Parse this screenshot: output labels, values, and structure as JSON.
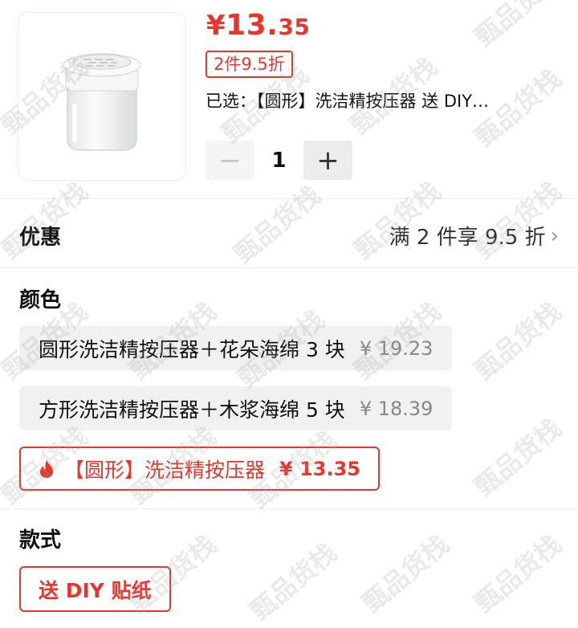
{
  "product": {
    "price_currency": "¥",
    "price_int": "13.",
    "price_dec": "35",
    "promo_tag": "2件9.5折",
    "selected_text": "已选：【圆形】洗洁精按压器 送 DIY…",
    "quantity": "1",
    "minus_symbol": "−",
    "plus_symbol": "+"
  },
  "discount": {
    "label": "优惠",
    "value": "满 2 件享 9.5 折",
    "chevron": "›"
  },
  "color_section": {
    "label": "颜色",
    "options": [
      {
        "name": "圆形洗洁精按压器＋花朵海绵 3 块",
        "price": "¥ 19.23",
        "state": "normal"
      },
      {
        "name": "方形洗洁精按压器＋木浆海绵 5 块",
        "price": "¥ 18.39",
        "state": "normal"
      },
      {
        "name": "【圆形】洗洁精按压器",
        "price": "¥ 13.35",
        "state": "selected",
        "icon": "flame-icon"
      }
    ]
  },
  "style_section": {
    "label": "款式",
    "option": "送 DIY 贴纸"
  },
  "watermark": {
    "text": "甄品货栈"
  },
  "colors": {
    "accent": "#e8362f",
    "chip_bg": "#f1f1f1",
    "muted": "#888888"
  }
}
